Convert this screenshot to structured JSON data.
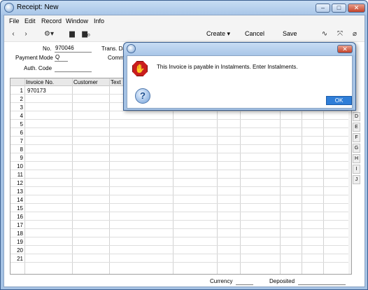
{
  "window": {
    "title": "Receipt: New"
  },
  "menu": [
    "File",
    "Edit",
    "Record",
    "Window",
    "Info"
  ],
  "toolbar": {
    "create": "Create",
    "cancel": "Cancel",
    "save": "Save"
  },
  "form": {
    "no_label": "No.",
    "no_value": "970046",
    "trans_label": "Trans. Da",
    "payment_mode_label": "Payment Mode",
    "payment_mode_value": "Q",
    "comment_label": "Comme",
    "auth_code_label": "Auth. Code",
    "auth_code_value": ""
  },
  "grid": {
    "headers": [
      "Invoice No.",
      "Customer",
      "Text"
    ],
    "rows": [
      "1",
      "2",
      "3",
      "4",
      "5",
      "6",
      "7",
      "8",
      "9",
      "10",
      "11",
      "12",
      "13",
      "14",
      "15",
      "16",
      "17",
      "18",
      "19",
      "20",
      "21"
    ],
    "first_row_invoice": "970173"
  },
  "side_tabs": [
    "D",
    "E",
    "F",
    "G",
    "H",
    "I",
    "J"
  ],
  "footer": {
    "currency_label": "Currency",
    "deposited_label": "Deposited"
  },
  "dialog": {
    "message": "This Invoice is payable in Instalments. Enter Instalments.",
    "ok_label": "OK"
  },
  "colors": {
    "title_bar": "#a9c6e8",
    "ok_button": "#2f7ed8",
    "stop_icon": "#c91d1d"
  }
}
